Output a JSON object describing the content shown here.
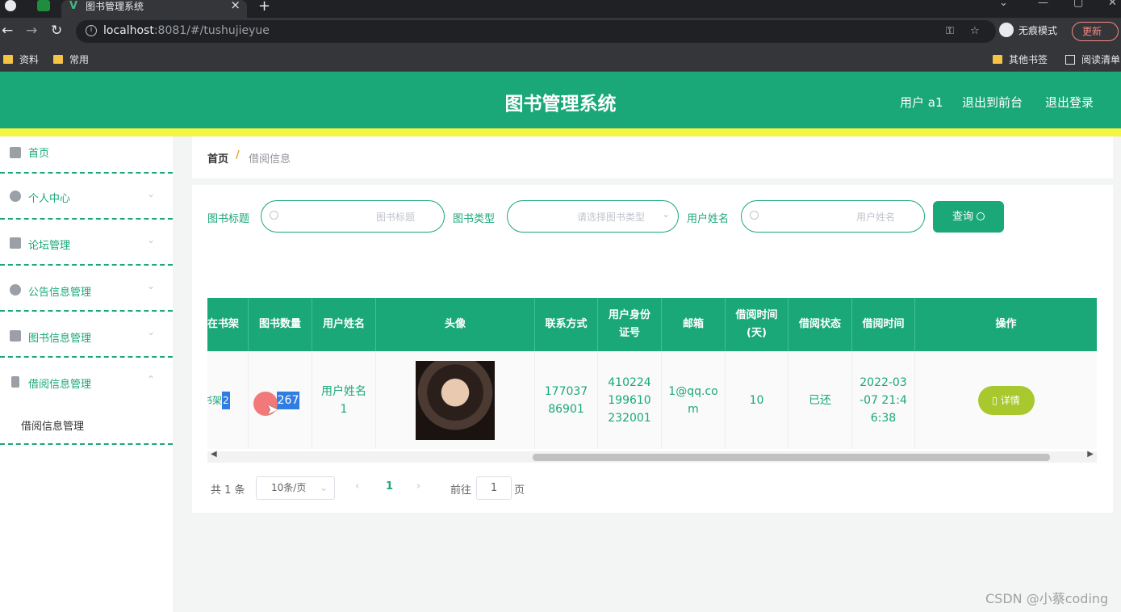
{
  "browser": {
    "tab_title": "图书管理系统",
    "tab_close": "×",
    "new_tab": "+",
    "url_host": "localhost",
    "url_rest": ":8081/#/tushujieyue",
    "incognito_label": "无痕模式",
    "update_label": "更新",
    "bookmarks": [
      "资料",
      "常用"
    ],
    "bookmarks_right": [
      "其他书签",
      "阅读清单"
    ]
  },
  "header": {
    "title": "图书管理系统",
    "links": [
      "用户 a1",
      "退出到前台",
      "退出登录"
    ]
  },
  "sidebar": {
    "items": [
      {
        "label": "首页",
        "icon": "home-icon"
      },
      {
        "label": "个人中心",
        "icon": "user-icon"
      },
      {
        "label": "论坛管理",
        "icon": "forum-icon"
      },
      {
        "label": "公告信息管理",
        "icon": "notice-icon"
      },
      {
        "label": "图书信息管理",
        "icon": "book-icon"
      },
      {
        "label": "借阅信息管理",
        "icon": "borrow-icon"
      }
    ],
    "subitem": "借阅信息管理"
  },
  "breadcrumb": {
    "home": "首页",
    "separator": "/",
    "current": "借阅信息"
  },
  "filters": {
    "title_label": "图书标题",
    "title_placeholder": "图书标题",
    "type_label": "图书类型",
    "type_placeholder": "请选择图书类型",
    "user_label": "用户姓名",
    "user_placeholder": "用户姓名",
    "query_label": "查询"
  },
  "table": {
    "headers": [
      "在书架",
      "图书数量",
      "用户姓名",
      "头像",
      "联系方式",
      "用户身份证号",
      "邮箱",
      "借阅时间(天)",
      "借阅状态",
      "借阅时间",
      "操作"
    ],
    "row": {
      "shelf_prefix": "书架",
      "shelf_value": "2",
      "quantity": "267",
      "user_name": "用户姓名1",
      "phone": "17703786901",
      "id_card": "410224199610232001",
      "email": "1@qq.com",
      "days": "10",
      "status": "已还",
      "borrow_time": "2022-03-07 21:46:38",
      "detail_label": "详情"
    }
  },
  "pagination": {
    "total": "共 1 条",
    "page_size": "10条/页",
    "current_page": "1",
    "goto_label": "前往",
    "goto_value": "1",
    "page_suffix": "页"
  },
  "watermark": "CSDN @小蔡coding"
}
